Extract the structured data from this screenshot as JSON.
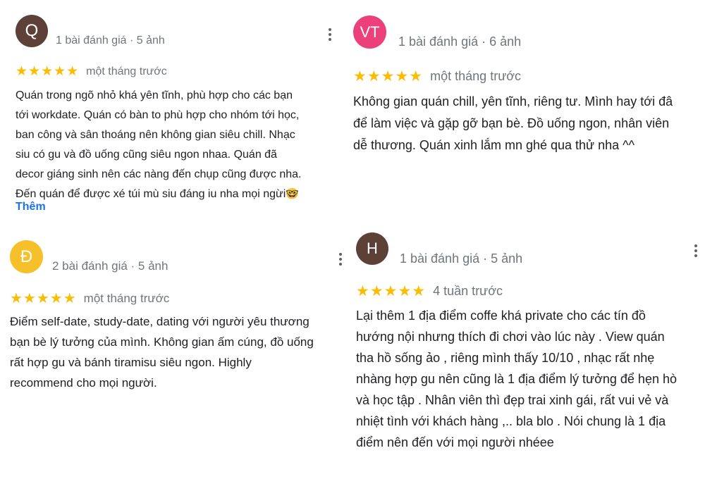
{
  "colors": {
    "star": "#fbbc04",
    "link": "#1a73e8",
    "muted": "#70757a",
    "avatar_q": "#5d4037",
    "avatar_vt": "#ec407a",
    "avatar_d": "#f6c02b",
    "avatar_h": "#5d4037"
  },
  "reviews": [
    {
      "initials": "Q",
      "meta": "1 bài đánh giá · 5 ảnh",
      "stars": "★★★★★",
      "date": "một tháng trước",
      "text": "Quán trong ngõ nhỏ khá yên tĩnh, phù hợp cho các bạn\ntới workdate. Quán có bàn to phù hợp cho nhóm tới học,\nban công và sân thoáng nên không gian siêu chill. Nhạc\nsiu có gu và đồ uống cũng siêu ngon nhaa. Quán đã\ndecor giáng sinh nên các nàng đến chụp cũng được nha.\nĐến quán để được xé túi mù siu đáng iu nha mọi ngừi",
      "emoji": "🤓",
      "more_label": "Thêm"
    },
    {
      "initials": "VT",
      "meta": "1 bài đánh giá · 6 ảnh",
      "stars": "★★★★★",
      "date": "một tháng trước",
      "text": "Không gian quán chill, yên tĩnh, riêng tư. Mình hay tới đâ\nđể làm việc và gặp gỡ bạn bè. Đồ uống ngon, nhân viên\ndễ thương. Quán xinh lắm mn ghé qua thử nha ^^"
    },
    {
      "initials": "Đ",
      "meta": "2 bài đánh giá · 5 ảnh",
      "stars": "★★★★★",
      "date": "một tháng trước",
      "text": "Điểm self-date, study-date, dating với người yêu thương\nbạn bè lý tưởng của mình. Không gian ấm cúng, đồ uống\nrất hợp gu và bánh tiramisu siêu ngon. Highly\nrecommend cho mọi người."
    },
    {
      "initials": "H",
      "meta": "1 bài đánh giá · 5 ảnh",
      "stars": "★★★★★",
      "date": "4 tuần trước",
      "text": "Lại thêm 1 địa điểm coffe khá private cho các tín đồ\nhướng nội nhưng thích đi chơi vào lúc này . View quán\ntha hồ sống ảo , riêng mình thấy 10/10 , nhạc rất nhẹ\nnhàng hợp gu nên cũng là 1 địa điểm lý tưởng để hẹn hò\nvà học tập . Nhân viên thì đẹp trai xinh gái, rất vui vẻ và\nnhiệt tình với khách hàng ,.. bla blo . Nói chung là 1 địa\nđiểm nên đến với mọi người nhéee"
    }
  ]
}
